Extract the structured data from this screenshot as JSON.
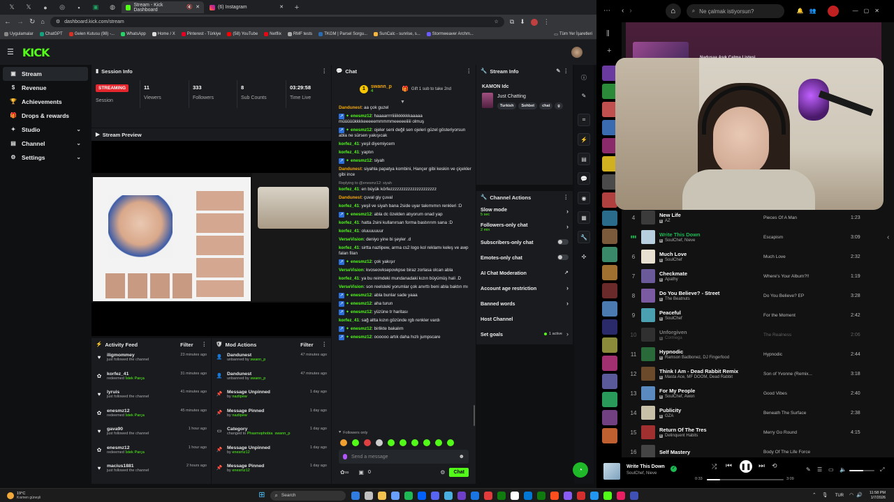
{
  "browser": {
    "tabs": [
      {
        "label": "Stream - Kick Dashboard",
        "active": true
      },
      {
        "label": "(6) Instagram",
        "active": false
      }
    ],
    "url": "dashboard.kick.com/stream",
    "bookmarks": [
      "Uygulamalar",
      "ChatGPT",
      "Gelen Kutusu (98) -...",
      "WhatsApp",
      "Home / X",
      "Pinterest - Türkiye",
      "(58) YouTube",
      "Netflix",
      "RMF tests",
      "TKGM | Parsel Sorgu...",
      "SunCalc - sunrise, s...",
      "Stormweaver Archm..."
    ],
    "bookmarks_right": "Tüm Yer İşaretleri",
    "bookmark_colors": [
      "#888",
      "#10a37f",
      "#d93025",
      "#25d366",
      "#ddd",
      "#e60023",
      "#ff0000",
      "#e50914",
      "#aaa",
      "#2b6cb0",
      "#f6b73c",
      "#6b5cff"
    ]
  },
  "kick": {
    "logo": "KICK",
    "sidebar": [
      {
        "label": "Stream",
        "active": true,
        "icon": "stream-icon"
      },
      {
        "label": "Revenue",
        "icon": "revenue-icon"
      },
      {
        "label": "Achievements",
        "icon": "trophy-icon"
      },
      {
        "label": "Drops & rewards",
        "icon": "gift-icon"
      },
      {
        "label": "Studio",
        "icon": "studio-icon",
        "expand": true
      },
      {
        "label": "Channel",
        "icon": "channel-icon",
        "expand": true
      },
      {
        "label": "Settings",
        "icon": "gear-icon",
        "expand": true
      }
    ],
    "session": {
      "title": "Session Info",
      "status": "STREAMING",
      "session_label": "Session",
      "stats": [
        {
          "value": "11",
          "label": "Viewers"
        },
        {
          "value": "333",
          "label": "Followers"
        },
        {
          "value": "8",
          "label": "Sub Counts"
        },
        {
          "value": "03:29:58",
          "label": "Time Live"
        }
      ]
    },
    "preview_title": "Stream Preview",
    "chat": {
      "title": "Chat",
      "pinned_user": "swann_p",
      "pinned_count": "4",
      "gift_text": "Gift 1 sub to take 2nd",
      "messages": [
        {
          "user": "Dandunest",
          "color": "#f7a900",
          "text": ": aa çok guzel"
        },
        {
          "user": "enesmz12",
          "color": "#53fc18",
          "text": ": haaaarrrriiiiikkkkkkaaaaa müüüüükkkkeeeeemmmmmeeeeeiiiii olmuş",
          "badge": true
        },
        {
          "user": "enesmz12",
          "color": "#53fc18",
          "text": ": ojeler seni değil sen ojeleri güzel gösteriyorsun abla ne sürsen yakışıcak",
          "badge": true
        },
        {
          "user": "korfez_41",
          "color": "#53fc18",
          "text": ": yeşil diyemiycem"
        },
        {
          "user": "korfez_41",
          "color": "#53fc18",
          "text": ": yaptın"
        },
        {
          "user": "enesmz12",
          "color": "#53fc18",
          "text": ": siyah",
          "badge": true
        },
        {
          "user": "Dandunest",
          "color": "#f7a900",
          "text": ": siyahla papatya kombini, Hançer gibi keskin ve çiçekler gibi ince"
        },
        {
          "user": "korfez_41",
          "color": "#53fc18",
          "text": ": en büyük körfezzzzzzzzzzzzzzzzzzzzz",
          "reply": "Replying to @enesmz12: siyah"
        },
        {
          "user": "Dandunest",
          "color": "#f7a900",
          "text": ": çuval giy çuval"
        },
        {
          "user": "korfez_41",
          "color": "#53fc18",
          "text": ": yeşil ve siyah bana 2side uyar takımımın renkleri :D"
        },
        {
          "user": "enesmz12",
          "color": "#53fc18",
          "text": ": abla dc özelden atıyorum onad yap",
          "badge": true
        },
        {
          "user": "korfez_41",
          "color": "#53fc18",
          "text": ": hatta 2sini kullanırsan forma bastırırım sana :D"
        },
        {
          "user": "korfez_41",
          "color": "#53fc18",
          "text": ": oluuuuuuur"
        },
        {
          "user": "VerseVision",
          "color": "#53fc18",
          "text": ": deniyo yine bi şeyler .d"
        },
        {
          "user": "korfez_41",
          "color": "#53fc18",
          "text": ": sirtta nazlipew, arma cs2 logo kol reklamı keleş ve awp falan filan"
        },
        {
          "user": "enesmz12",
          "color": "#53fc18",
          "text": ": çok yakışır",
          "badge": true
        },
        {
          "user": "VerseVision",
          "color": "#53fc18",
          "text": ": kvoseovksepovkpse biraz zorlasa olcan abla"
        },
        {
          "user": "korfez_41",
          "color": "#53fc18",
          "text": ": ya bu reimdeki mundanadaki kızın büyümüş hali .D"
        },
        {
          "user": "VerseVision",
          "color": "#53fc18",
          "text": ": son reelsteki yorumlar çok anırttı beni abla baktın mı"
        },
        {
          "user": "enesmz12",
          "color": "#53fc18",
          "text": ": abla bunlar sade yaaa",
          "badge": true
        },
        {
          "user": "enesmz12",
          "color": "#53fc18",
          "text": ": aha turun",
          "badge": true
        },
        {
          "user": "enesmz12",
          "color": "#53fc18",
          "text": ": yüzüne tr haritası",
          "badge": true
        },
        {
          "user": "korfez_41",
          "color": "#53fc18",
          "text": ": sağ altta kızın gözünde rgb renkler vardı"
        },
        {
          "user": "enesmz12",
          "color": "#53fc18",
          "text": ": birlikte bakalım",
          "badge": true
        },
        {
          "user": "enesmz12",
          "color": "#53fc18",
          "text": ": oooooo artık daha hızlı jumpscare",
          "badge": true
        }
      ],
      "followers_only": "Followers only",
      "placeholder": "Send a message",
      "send": "Chat",
      "points": "0"
    },
    "stream_info": {
      "title": "Stream Info",
      "stream_title": "KAMON Idc",
      "category": "Just Chatting",
      "tags": [
        "Turkish",
        "Sohbet",
        "chat",
        "g"
      ]
    },
    "channel_actions": {
      "title": "Channel Actions",
      "items": [
        {
          "label": "Slow mode",
          "sub": "5 sec",
          "kind": "arrow"
        },
        {
          "label": "Followers-only chat",
          "sub": "2 min",
          "kind": "arrow"
        },
        {
          "label": "Subscribers-only chat",
          "kind": "toggle"
        },
        {
          "label": "Emotes-only chat",
          "kind": "toggle"
        },
        {
          "label": "AI Chat Moderation",
          "kind": "link"
        },
        {
          "label": "Account age restriction",
          "kind": "arrow"
        },
        {
          "label": "Banned words",
          "kind": "arrow"
        },
        {
          "label": "Host Channel",
          "kind": "none"
        },
        {
          "label": "Set goals",
          "kind": "goal",
          "sub": "1 active"
        }
      ]
    },
    "activity": {
      "title": "Activity Feed",
      "filter": "Filter",
      "items": [
        {
          "user": "iligmommey",
          "action": "just followed the channel",
          "time": "23 minutes ago",
          "kind": "follow"
        },
        {
          "user": "korfez_41",
          "action": "redeemed",
          "reward": "İstek Parça",
          "time": "31 minutes ago",
          "kind": "redeem"
        },
        {
          "user": "lyruis",
          "action": "just followed the channel",
          "time": "41 minutes ago",
          "kind": "follow"
        },
        {
          "user": "enesmz12",
          "action": "redeemed",
          "reward": "İstek Parça",
          "time": "45 minutes ago",
          "kind": "redeem"
        },
        {
          "user": "gava90",
          "action": "just followed the channel",
          "time": "1 hour ago",
          "kind": "follow"
        },
        {
          "user": "enesmz12",
          "action": "redeemed",
          "reward": "İstek Parça",
          "time": "1 hour ago",
          "kind": "redeem"
        },
        {
          "user": "macius1881",
          "action": "just followed the channel",
          "time": "2 hours ago",
          "kind": "follow"
        }
      ]
    },
    "mod": {
      "title": "Mod Actions",
      "filter": "Filter",
      "items": [
        {
          "title": "Dandunest",
          "sub": "unbanned by",
          "by": "swann_p",
          "time": "47 minutes ago",
          "icon": "user-icon"
        },
        {
          "title": "Dandunest",
          "sub": "unbanned by",
          "by": "swann_p",
          "time": "47 minutes ago",
          "icon": "user-icon"
        },
        {
          "title": "Message Unpinned",
          "sub": "by",
          "by": "nazlipew",
          "time": "1 day ago",
          "icon": "pin-icon"
        },
        {
          "title": "Message Pinned",
          "sub": "by",
          "by": "nazlipew",
          "time": "1 day ago",
          "icon": "pin-icon"
        },
        {
          "title": "Category",
          "sub": "changed to",
          "by": "Phasmophobia",
          "by2": "swann_p",
          "time": "1 day ago",
          "icon": "folder-icon"
        },
        {
          "title": "Message Unpinned",
          "sub": "by",
          "by": "enesmz12",
          "time": "1 day ago",
          "icon": "pin-icon"
        },
        {
          "title": "Message Pinned",
          "sub": "by",
          "by": "enesmz12",
          "time": "1 day ago",
          "icon": "pin-icon"
        }
      ]
    }
  },
  "spotify": {
    "search_placeholder": "Ne çalmak istiyorsun?",
    "tracks": [
      {
        "n": "4",
        "title": "New Life",
        "artist": "AZ",
        "album": "Pieces Of A Man",
        "dur": "1:23",
        "color": "#3b3b3b"
      },
      {
        "n": "",
        "title": "Write This Down",
        "artist": "SoulChef, Nieve",
        "album": "Escapism",
        "dur": "3:09",
        "playing": true,
        "color": "#b8cfe0"
      },
      {
        "n": "6",
        "title": "Much Love",
        "artist": "SoulChef",
        "album": "Much Love",
        "dur": "2:32",
        "color": "#e8e0d0"
      },
      {
        "n": "7",
        "title": "Checkmate",
        "artist": "Apathy",
        "album": "Where's Your Album?!!",
        "dur": "1:19",
        "color": "#6a5a9a"
      },
      {
        "n": "8",
        "title": "Do You Believe? - Street",
        "artist": "The Beatnuts",
        "album": "Do You Believe? EP",
        "dur": "3:28",
        "color": "#7a5aa0"
      },
      {
        "n": "9",
        "title": "Peaceful",
        "artist": "SoulChef",
        "album": "For the Moment",
        "dur": "2:42",
        "color": "#4aa0b0"
      },
      {
        "n": "10",
        "title": "Unforgiven",
        "artist": "Cormega",
        "album": "The Realness",
        "dur": "2:06",
        "dim": true,
        "color": "#555"
      },
      {
        "n": "11",
        "title": "Hypnodic",
        "artist": "Ramson Badbonez, DJ Fingerfood",
        "album": "Hypnodic",
        "dur": "2:44",
        "color": "#2a6a3a"
      },
      {
        "n": "12",
        "title": "Think I Am - Dead Rabbit Remix",
        "artist": "Masta Ace, MF DOOM, Dead Rabbit",
        "album": "Son of Yvonne (Remix...",
        "dur": "3:18",
        "color": "#6a4a2a"
      },
      {
        "n": "13",
        "title": "For My People",
        "artist": "SoulChef, Awon",
        "album": "Good Vibes",
        "dur": "2:40",
        "color": "#5a8ac0"
      },
      {
        "n": "14",
        "title": "Publicity",
        "artist": "GZA",
        "album": "Beneath The Surface",
        "dur": "2:38",
        "color": "#c8c0a8"
      },
      {
        "n": "15",
        "title": "Return Of The Tres",
        "artist": "Delinquent Habits",
        "album": "Merry Go Round",
        "dur": "4:15",
        "color": "#a03030"
      },
      {
        "n": "16",
        "title": "Self Mastery",
        "artist": "",
        "album": "Body Of The Life Force",
        "dur": "",
        "color": "#444"
      }
    ],
    "header_partial": "Nadusaa Asık Calma Listesi",
    "now_playing": {
      "title": "Write This Down",
      "artist": "SoulChef, Nieve",
      "elapsed": "0:33",
      "total": "3:09",
      "progress": 0.17,
      "volume": 0.55
    }
  },
  "taskbar": {
    "weather_temp": "19°C",
    "weather_text": "Kısmen güneşli",
    "search": "Search",
    "lang": "TUR",
    "time": "11:58 PM",
    "date": "1/7/2026",
    "app_colors": [
      "#2f7de1",
      "#c0c0c0",
      "#f2c14e",
      "#6aa0ff",
      "#1db954",
      "#0061ff",
      "#5865f2",
      "#4ab0e0",
      "#6e40c9",
      "#1b74e4",
      "#e33b3b",
      "#107c10",
      "#ffffff",
      "#0078d4",
      "#0f7b0f",
      "#ff4f1f",
      "#8a5cf6",
      "#d32f2f",
      "#2196f3",
      "#53fc18",
      "#e91e63",
      "#3f51b5"
    ]
  }
}
